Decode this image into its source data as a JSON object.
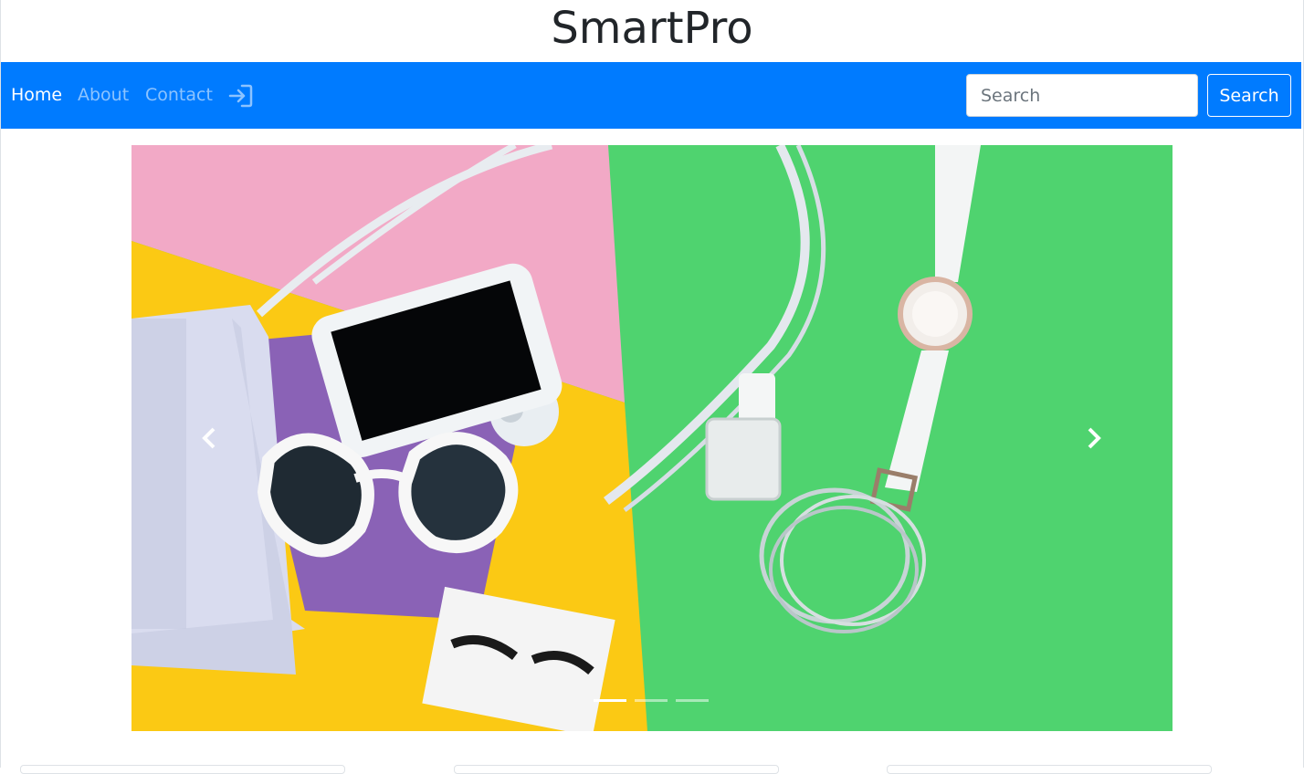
{
  "brand": {
    "title": "SmartPro"
  },
  "nav": {
    "items": [
      {
        "label": "Home",
        "active": true
      },
      {
        "label": "About",
        "active": false
      },
      {
        "label": "Contact",
        "active": false
      }
    ],
    "login_icon": "sign-in-icon",
    "search": {
      "placeholder": "Search",
      "value": "",
      "button_label": "Search"
    }
  },
  "carousel": {
    "slide_image": "flat-lay of white handbag, phone, heart-shaped sunglasses, false eyelashes, nail polish, watch and bangles on pink, yellow and green background",
    "prev_icon": "chevron-left-icon",
    "next_icon": "chevron-right-icon",
    "indicator_count": 3,
    "active_index": 0
  },
  "colors": {
    "primary": "#007bff",
    "pink": "#f2a9c6",
    "yellow": "#fbc914",
    "green": "#4fd36f"
  }
}
